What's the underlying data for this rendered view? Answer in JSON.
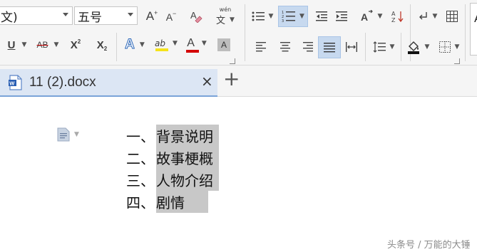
{
  "ribbon": {
    "font_name_partial": "文)",
    "font_size": "五号",
    "increase_font": "A",
    "decrease_font": "A",
    "phonetic_guide": "wén",
    "phonetic_char": "文",
    "superscript": "X",
    "subscript": "X",
    "superscript_mark": "2",
    "subscript_mark": "2",
    "underline": "U",
    "strikethrough": "AB",
    "text_effect": "A",
    "highlight": "ab",
    "font_color": "A",
    "char_shading": "A",
    "cut_label": "A",
    "colors": {
      "highlight_yellow": "#f5e31b",
      "font_color_red": "#d40000",
      "active_blue": "#c7d9ef"
    }
  },
  "tab": {
    "filename": "11 (2).docx",
    "close": "×",
    "new_tab": "+"
  },
  "document": {
    "lines": [
      {
        "num": "一、",
        "text": "背景说明"
      },
      {
        "num": "二、",
        "text": "故事梗概"
      },
      {
        "num": "三、",
        "text": "人物介绍"
      },
      {
        "num": "四、",
        "text": "剧情"
      }
    ]
  },
  "watermark": "头条号 / 万能的大锤"
}
